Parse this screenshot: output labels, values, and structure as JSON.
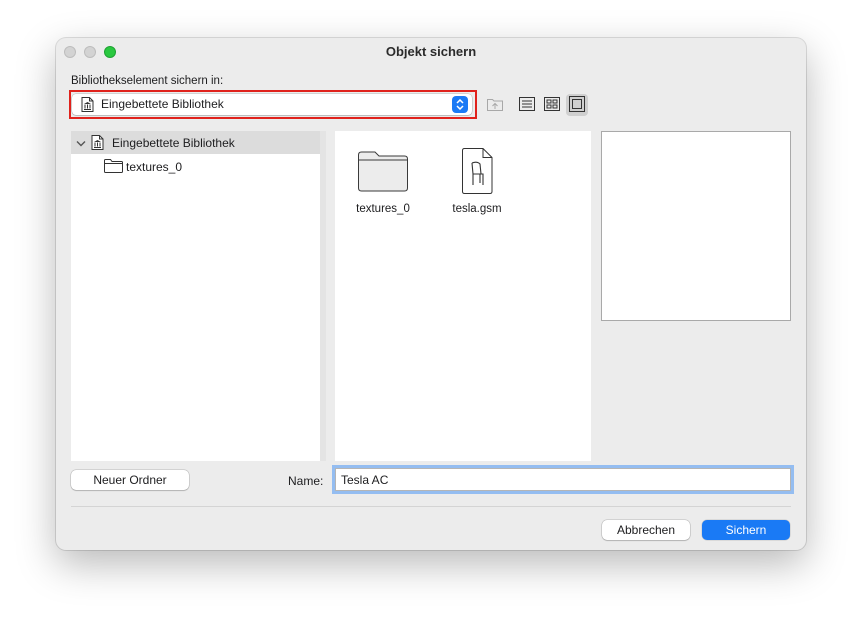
{
  "window": {
    "title": "Objekt sichern"
  },
  "location": {
    "label": "Bibliothekselement sichern in:",
    "selected": "Eingebettete Bibliothek"
  },
  "toolbar": {
    "icons": [
      "folder-up-icon",
      "list-view-icon",
      "icon-view-icon",
      "preview-view-icon"
    ],
    "active_view": "preview-view"
  },
  "tree": {
    "items": [
      {
        "label": "Eingebettete Bibliothek",
        "icon": "library-icon",
        "expanded": true,
        "selected": true
      },
      {
        "label": "textures_0",
        "icon": "folder-icon",
        "selected": false
      }
    ]
  },
  "files": {
    "items": [
      {
        "label": "textures_0",
        "icon": "folder-icon"
      },
      {
        "label": "tesla.gsm",
        "icon": "gsm-object-icon"
      }
    ]
  },
  "footer": {
    "new_folder_label": "Neuer Ordner",
    "name_label": "Name:",
    "name_value": "Tesla AC",
    "cancel_label": "Abbrechen",
    "save_label": "Sichern"
  },
  "colors": {
    "accent": "#1a7af5",
    "highlight_box": "#e0221c",
    "zoom_button": "#2ac840"
  }
}
